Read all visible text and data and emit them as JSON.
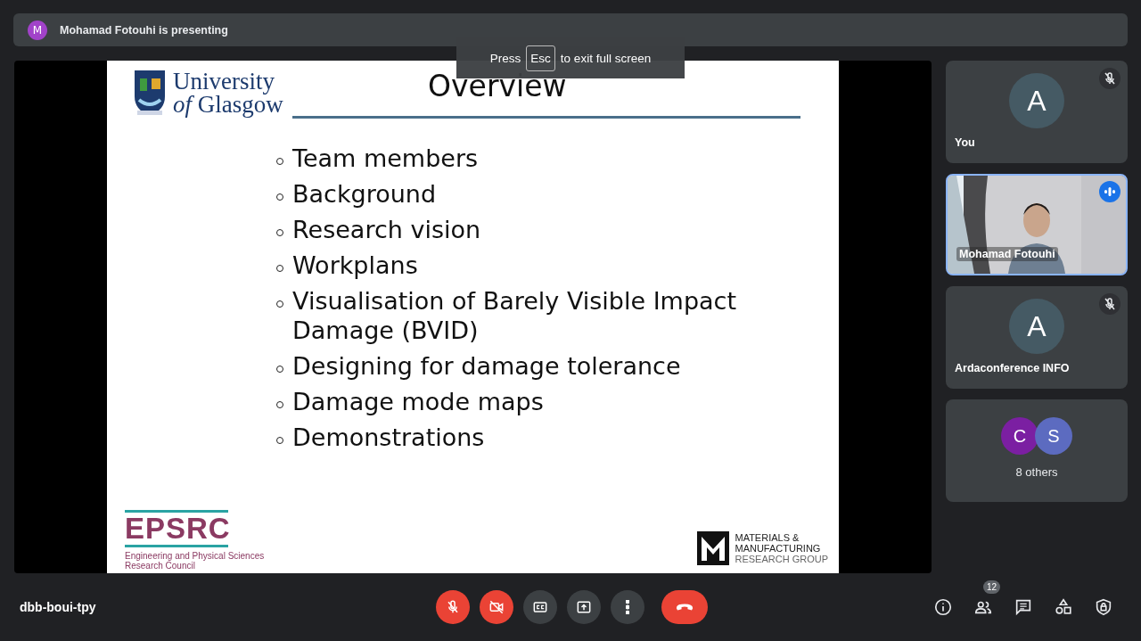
{
  "presenter_banner": {
    "avatar_letter": "M",
    "text": "Mohamad Fotouhi is presenting"
  },
  "fullscreen_toast": {
    "prefix": "Press",
    "key": "Esc",
    "suffix": "to exit full screen"
  },
  "slide": {
    "title": "Overview",
    "university_logo": {
      "line_1": "University",
      "line_2": "*of* Glasgow"
    },
    "bullets": [
      "Team members",
      "Background",
      "Research vision",
      "Workplans",
      "Visualisation of Barely Visible Impact Damage (BVID)",
      "Designing for damage tolerance",
      "Damage mode maps",
      "Demonstrations"
    ],
    "epsrc_logo": {
      "name": "EPSRC",
      "line_1": "Engineering and Physical Sciences",
      "line_2": "Research Council"
    },
    "group_logo": {
      "lines": [
        "MATERIALS &",
        "MANUFACTURING",
        "RESEARCH GROUP"
      ]
    }
  },
  "participants": [
    {
      "kind": "avatar",
      "letter": "A",
      "name": "You",
      "muted": true,
      "speaking": false
    },
    {
      "kind": "video",
      "name": "Mohamad Fotouhi",
      "muted": false,
      "speaking": true
    },
    {
      "kind": "avatar",
      "letter": "A",
      "name": "Ardaconference INFO",
      "muted": true,
      "speaking": false
    },
    {
      "kind": "others",
      "avatars": [
        {
          "letter": "C",
          "color": "#7b1fa2"
        },
        {
          "letter": "S",
          "color": "#5c6bc0"
        }
      ],
      "label": "8 others"
    }
  ],
  "meeting_code": "dbb-boui-tpy",
  "center_controls": [
    {
      "kind": "mic",
      "on": false
    },
    {
      "kind": "camera",
      "on": false
    },
    {
      "kind": "captions"
    },
    {
      "kind": "present"
    },
    {
      "kind": "more"
    },
    {
      "kind": "end"
    }
  ],
  "right_controls": [
    {
      "kind": "info"
    },
    {
      "kind": "people",
      "badge": "12"
    },
    {
      "kind": "chat"
    },
    {
      "kind": "activities"
    },
    {
      "kind": "host"
    }
  ]
}
